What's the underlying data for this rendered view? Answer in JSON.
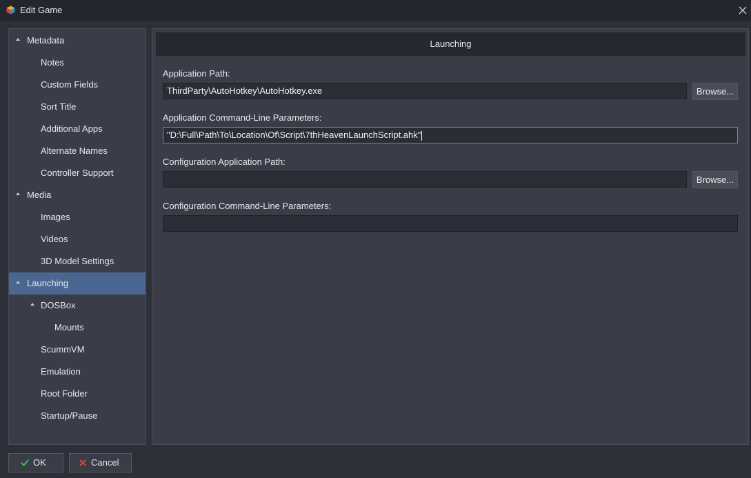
{
  "window": {
    "title": "Edit Game",
    "app_icon": "launchbox-cube-icon",
    "close_icon": "close-icon"
  },
  "sidebar": {
    "items": [
      {
        "label": "Metadata",
        "expanded": true
      },
      {
        "label": "Notes"
      },
      {
        "label": "Custom Fields"
      },
      {
        "label": "Sort Title"
      },
      {
        "label": "Additional Apps"
      },
      {
        "label": "Alternate Names"
      },
      {
        "label": "Controller Support"
      },
      {
        "label": "Media",
        "expanded": true
      },
      {
        "label": "Images"
      },
      {
        "label": "Videos"
      },
      {
        "label": "3D Model Settings"
      },
      {
        "label": "Launching",
        "expanded": true,
        "selected": true
      },
      {
        "label": "DOSBox",
        "expanded": true
      },
      {
        "label": "Mounts"
      },
      {
        "label": "ScummVM"
      },
      {
        "label": "Emulation"
      },
      {
        "label": "Root Folder"
      },
      {
        "label": "Startup/Pause"
      }
    ]
  },
  "panel": {
    "header": "Launching",
    "app_path": {
      "label": "Application Path:",
      "value": "ThirdParty\\AutoHotkey\\AutoHotkey.exe",
      "browse_label": "Browse..."
    },
    "app_params": {
      "label": "Application Command-Line Parameters:",
      "value": "\"D:\\Full\\Path\\To\\Location\\Of\\Script\\7thHeavenLaunchScript.ahk\""
    },
    "config_path": {
      "label": "Configuration Application Path:",
      "value": "",
      "browse_label": "Browse..."
    },
    "config_params": {
      "label": "Configuration Command-Line Parameters:",
      "value": ""
    }
  },
  "footer": {
    "ok_label": "OK",
    "cancel_label": "Cancel"
  },
  "colors": {
    "window_bg": "#2d3038",
    "panel_bg": "#3a3d47",
    "selected": "#4a6792",
    "ok_icon": "#3fbf4f",
    "cancel_icon": "#e0443c"
  }
}
